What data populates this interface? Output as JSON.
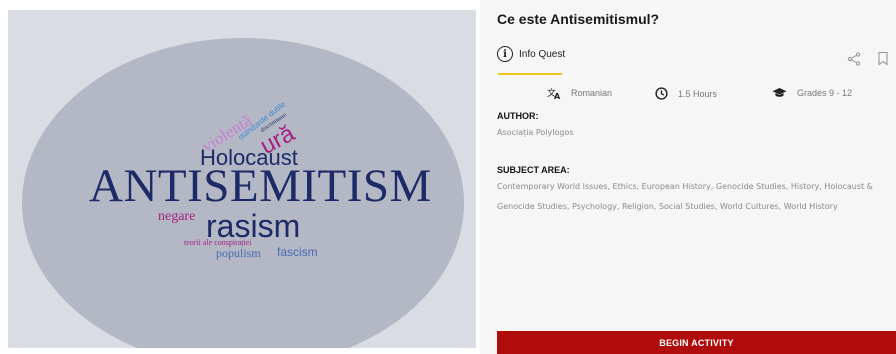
{
  "activity": {
    "title": "Ce este Antisemitismul?",
    "type_label": "Info Quest",
    "type_icon": "info-circle-icon",
    "accent_color": "#f0c419"
  },
  "meta": {
    "language": "Romanian",
    "duration": "1.5 Hours",
    "grades": "Grades 9 - 12"
  },
  "author": {
    "label": "AUTHOR:",
    "name": "Asociația Polylogos"
  },
  "subject": {
    "label": "SUBJECT AREA:",
    "areas": "Contemporary World Issues, Ethics, European History, Genocide Studies, History, Holocaust & Genocide Studies, Psychology, Religion, Social Studies, World Cultures, World History"
  },
  "cta": {
    "begin_label": "BEGIN ACTIVITY",
    "color": "#b10c0c"
  },
  "word_cloud": {
    "antisemitism": "ANTISEMITISM",
    "holocaust": "Holocaust",
    "rasism": "rasism",
    "negare": "negare",
    "teorii": "teorii ale conspirației",
    "populism": "populism",
    "fascism": "fascism",
    "ura": "ură",
    "violenta": "violență",
    "standarde": "standarde duble",
    "discriminare": "discriminare"
  }
}
